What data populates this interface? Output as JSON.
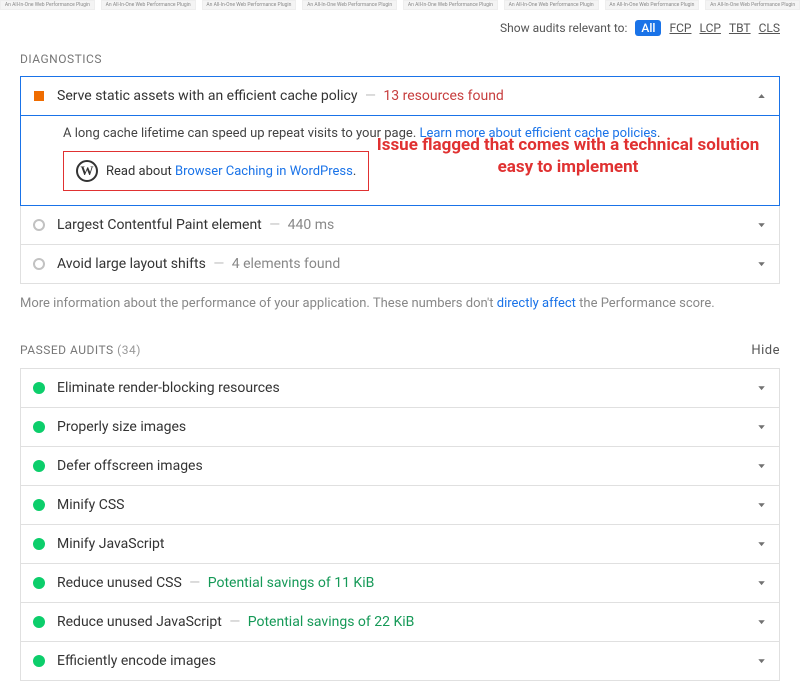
{
  "thumb_label": "An All-In-One Web Performance Plugin",
  "filters": {
    "label": "Show audits relevant to:",
    "items": [
      "All",
      "FCP",
      "LCP",
      "TBT",
      "CLS"
    ],
    "active": "All"
  },
  "diagnostics": {
    "heading": "DIAGNOSTICS",
    "expanded": {
      "title": "Serve static assets with an efficient cache policy",
      "detail": "13 resources found",
      "desc_pre": "A long cache lifetime can speed up repeat visits to your page. ",
      "desc_link": "Learn more about efficient cache policies",
      "read_pre": "Read about ",
      "read_link": "Browser Caching in WordPress"
    },
    "items": [
      {
        "title": "Largest Contentful Paint element",
        "detail": "440 ms"
      },
      {
        "title": "Avoid large layout shifts",
        "detail": "4 elements found"
      }
    ]
  },
  "more_info": {
    "pre": "More information about the performance of your application. These numbers don't ",
    "link": "directly affect",
    "post": " the Performance score."
  },
  "passed": {
    "heading": "PASSED AUDITS",
    "count": "(34)",
    "hide": "Hide",
    "items": [
      {
        "title": "Eliminate render-blocking resources",
        "detail": ""
      },
      {
        "title": "Properly size images",
        "detail": ""
      },
      {
        "title": "Defer offscreen images",
        "detail": ""
      },
      {
        "title": "Minify CSS",
        "detail": ""
      },
      {
        "title": "Minify JavaScript",
        "detail": ""
      },
      {
        "title": "Reduce unused CSS",
        "detail": "Potential savings of 11 KiB"
      },
      {
        "title": "Reduce unused JavaScript",
        "detail": "Potential savings of 22 KiB"
      },
      {
        "title": "Efficiently encode images",
        "detail": ""
      }
    ]
  },
  "annotation": "Issue flagged that comes with a technical solution easy to implement"
}
